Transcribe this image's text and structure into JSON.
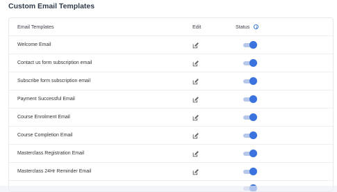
{
  "page": {
    "title": "Custom Email Templates"
  },
  "table": {
    "headers": {
      "templates": "Email Templates",
      "edit": "Edit",
      "status": "Status"
    },
    "rows": [
      {
        "label": "Welcome Email",
        "enabled": true
      },
      {
        "label": "Contact us form subscription email",
        "enabled": true
      },
      {
        "label": "Subscribe form subscription email",
        "enabled": true
      },
      {
        "label": "Payment Successful Email",
        "enabled": true
      },
      {
        "label": "Course Enrolment Email",
        "enabled": true
      },
      {
        "label": "Course Completion Email",
        "enabled": true
      },
      {
        "label": "Masterclass Registration Email",
        "enabled": true
      },
      {
        "label": "Masterclass 24Hr Reminder Email",
        "enabled": true
      }
    ]
  },
  "icons": {
    "info": "info-icon",
    "edit": "edit-icon",
    "toggle": "toggle-switch"
  },
  "colors": {
    "accent": "#3a73de",
    "toggle_track": "#b7c7e9",
    "border": "#eceef2"
  }
}
